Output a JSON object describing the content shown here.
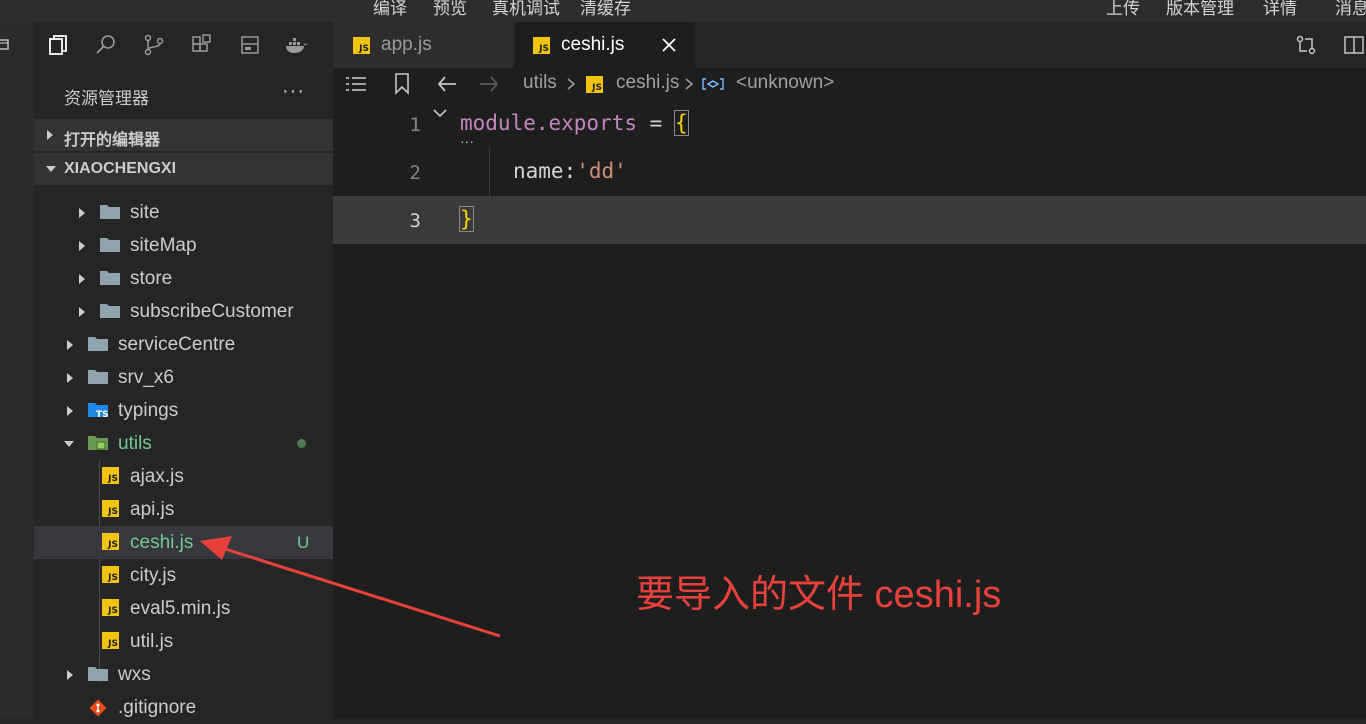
{
  "top_menu": {
    "left": [
      "编译",
      "预览",
      "真机调试",
      "清缓存"
    ],
    "right": [
      "上传",
      "版本管理",
      "详情",
      "消息"
    ]
  },
  "sidebar": {
    "title": "资源管理器",
    "more": "···",
    "sections": [
      {
        "label": "打开的编辑器",
        "expanded": false
      },
      {
        "label": "XIAOCHENGXI",
        "expanded": true
      }
    ],
    "tree": [
      {
        "name": "site",
        "type": "folder",
        "expanded": false
      },
      {
        "name": "siteMap",
        "type": "folder",
        "expanded": false
      },
      {
        "name": "store",
        "type": "folder",
        "expanded": false
      },
      {
        "name": "subscribeCustomer",
        "type": "folder",
        "expanded": false
      },
      {
        "name": "serviceCentre",
        "type": "folder",
        "expanded": false
      },
      {
        "name": "srv_x6",
        "type": "folder",
        "expanded": false
      },
      {
        "name": "typings",
        "type": "ts-folder",
        "expanded": false
      },
      {
        "name": "utils",
        "type": "folder-modified",
        "expanded": true
      },
      {
        "name": "ajax.js",
        "type": "js"
      },
      {
        "name": "api.js",
        "type": "js"
      },
      {
        "name": "ceshi.js",
        "type": "js",
        "status": "U",
        "selected": true
      },
      {
        "name": "city.js",
        "type": "js"
      },
      {
        "name": "eval5.min.js",
        "type": "js"
      },
      {
        "name": "util.js",
        "type": "js"
      },
      {
        "name": "wxs",
        "type": "folder",
        "expanded": false
      },
      {
        "name": ".gitignore",
        "type": "git"
      }
    ]
  },
  "tabs": [
    {
      "label": "app.js",
      "active": false
    },
    {
      "label": "ceshi.js",
      "active": true
    }
  ],
  "breadcrumb": {
    "folder": "utils",
    "file": "ceshi.js",
    "symbol": "<unknown>"
  },
  "editor": {
    "line_numbers": [
      "1",
      "2",
      "3"
    ],
    "lines": {
      "l1_kw": "module.exports",
      "l1_op": " = ",
      "l1_brace": "{",
      "l2_key": "name",
      "l2_colon": ":",
      "l2_str": "'dd'",
      "l3_brace": "}"
    },
    "fold_dots": "···"
  },
  "annotation": "要导入的文件 ceshi.js",
  "colors": {
    "accent_green": "#73c991",
    "annotation_red": "#e8413c",
    "keyword_purple": "#c586c0",
    "string_orange": "#ce9178",
    "brace_yellow": "#ffd700"
  }
}
